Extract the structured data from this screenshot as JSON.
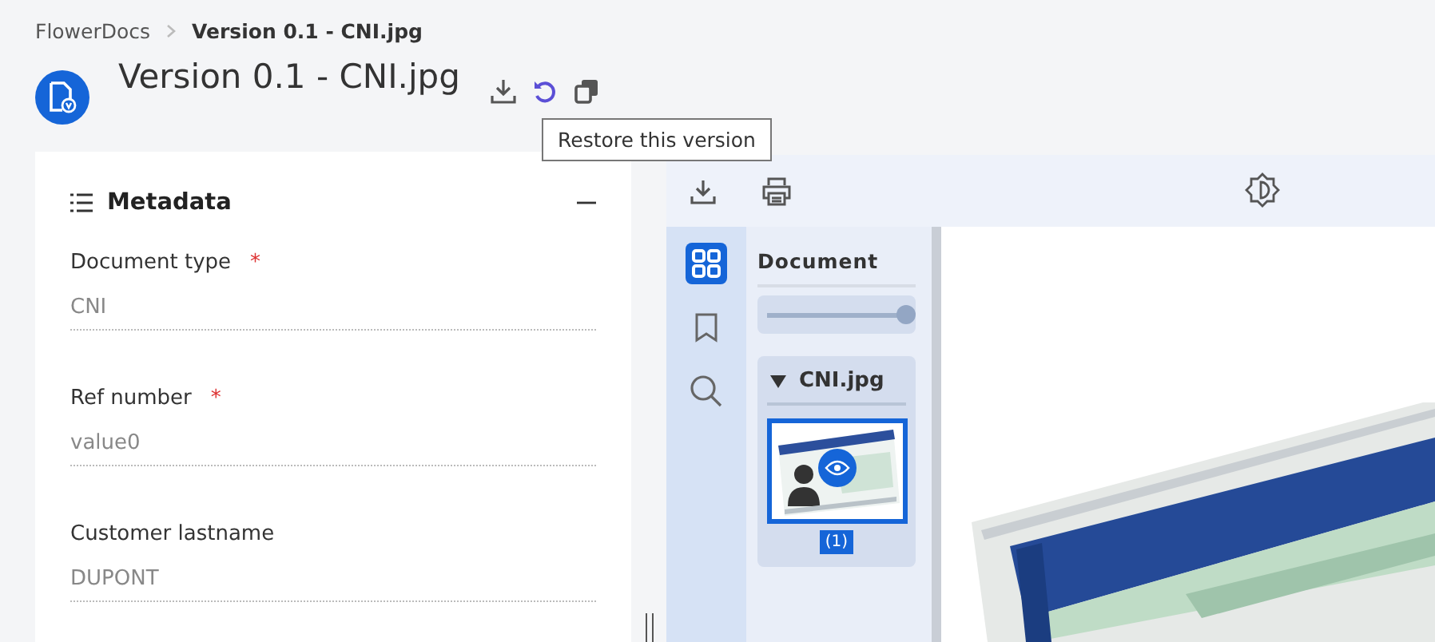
{
  "breadcrumb": [
    {
      "label": "FlowerDocs",
      "current": false
    },
    {
      "label": "Version 0.1 - CNI.jpg",
      "current": true
    }
  ],
  "title": "Version 0.1 - CNI.jpg",
  "title_actions": [
    {
      "kind": "download"
    },
    {
      "kind": "restore"
    },
    {
      "kind": "copy"
    }
  ],
  "tooltip": "Restore this version",
  "metadata": {
    "title": "Metadata",
    "expanded": true,
    "fields": [
      {
        "label": "Document type",
        "required_mark": "*",
        "value": "CNI"
      },
      {
        "label": "Ref number",
        "required_mark": "*",
        "value": "value0"
      },
      {
        "label": "Customer lastname",
        "value": "DUPONT"
      }
    ]
  },
  "viewer": {
    "toolbar": [
      {
        "kind": "download"
      },
      {
        "kind": "print"
      }
    ],
    "rail": [
      {
        "kind": "thumbnails",
        "selected": true
      },
      {
        "kind": "bookmarks",
        "selected": false
      },
      {
        "kind": "search",
        "selected": false
      }
    ],
    "panel_title": "Document",
    "zoom": {
      "level": 1
    },
    "file": {
      "name": "CNI.jpg",
      "expanded": true,
      "pages": [
        {
          "label": "(1)",
          "selected": true
        }
      ]
    }
  }
}
